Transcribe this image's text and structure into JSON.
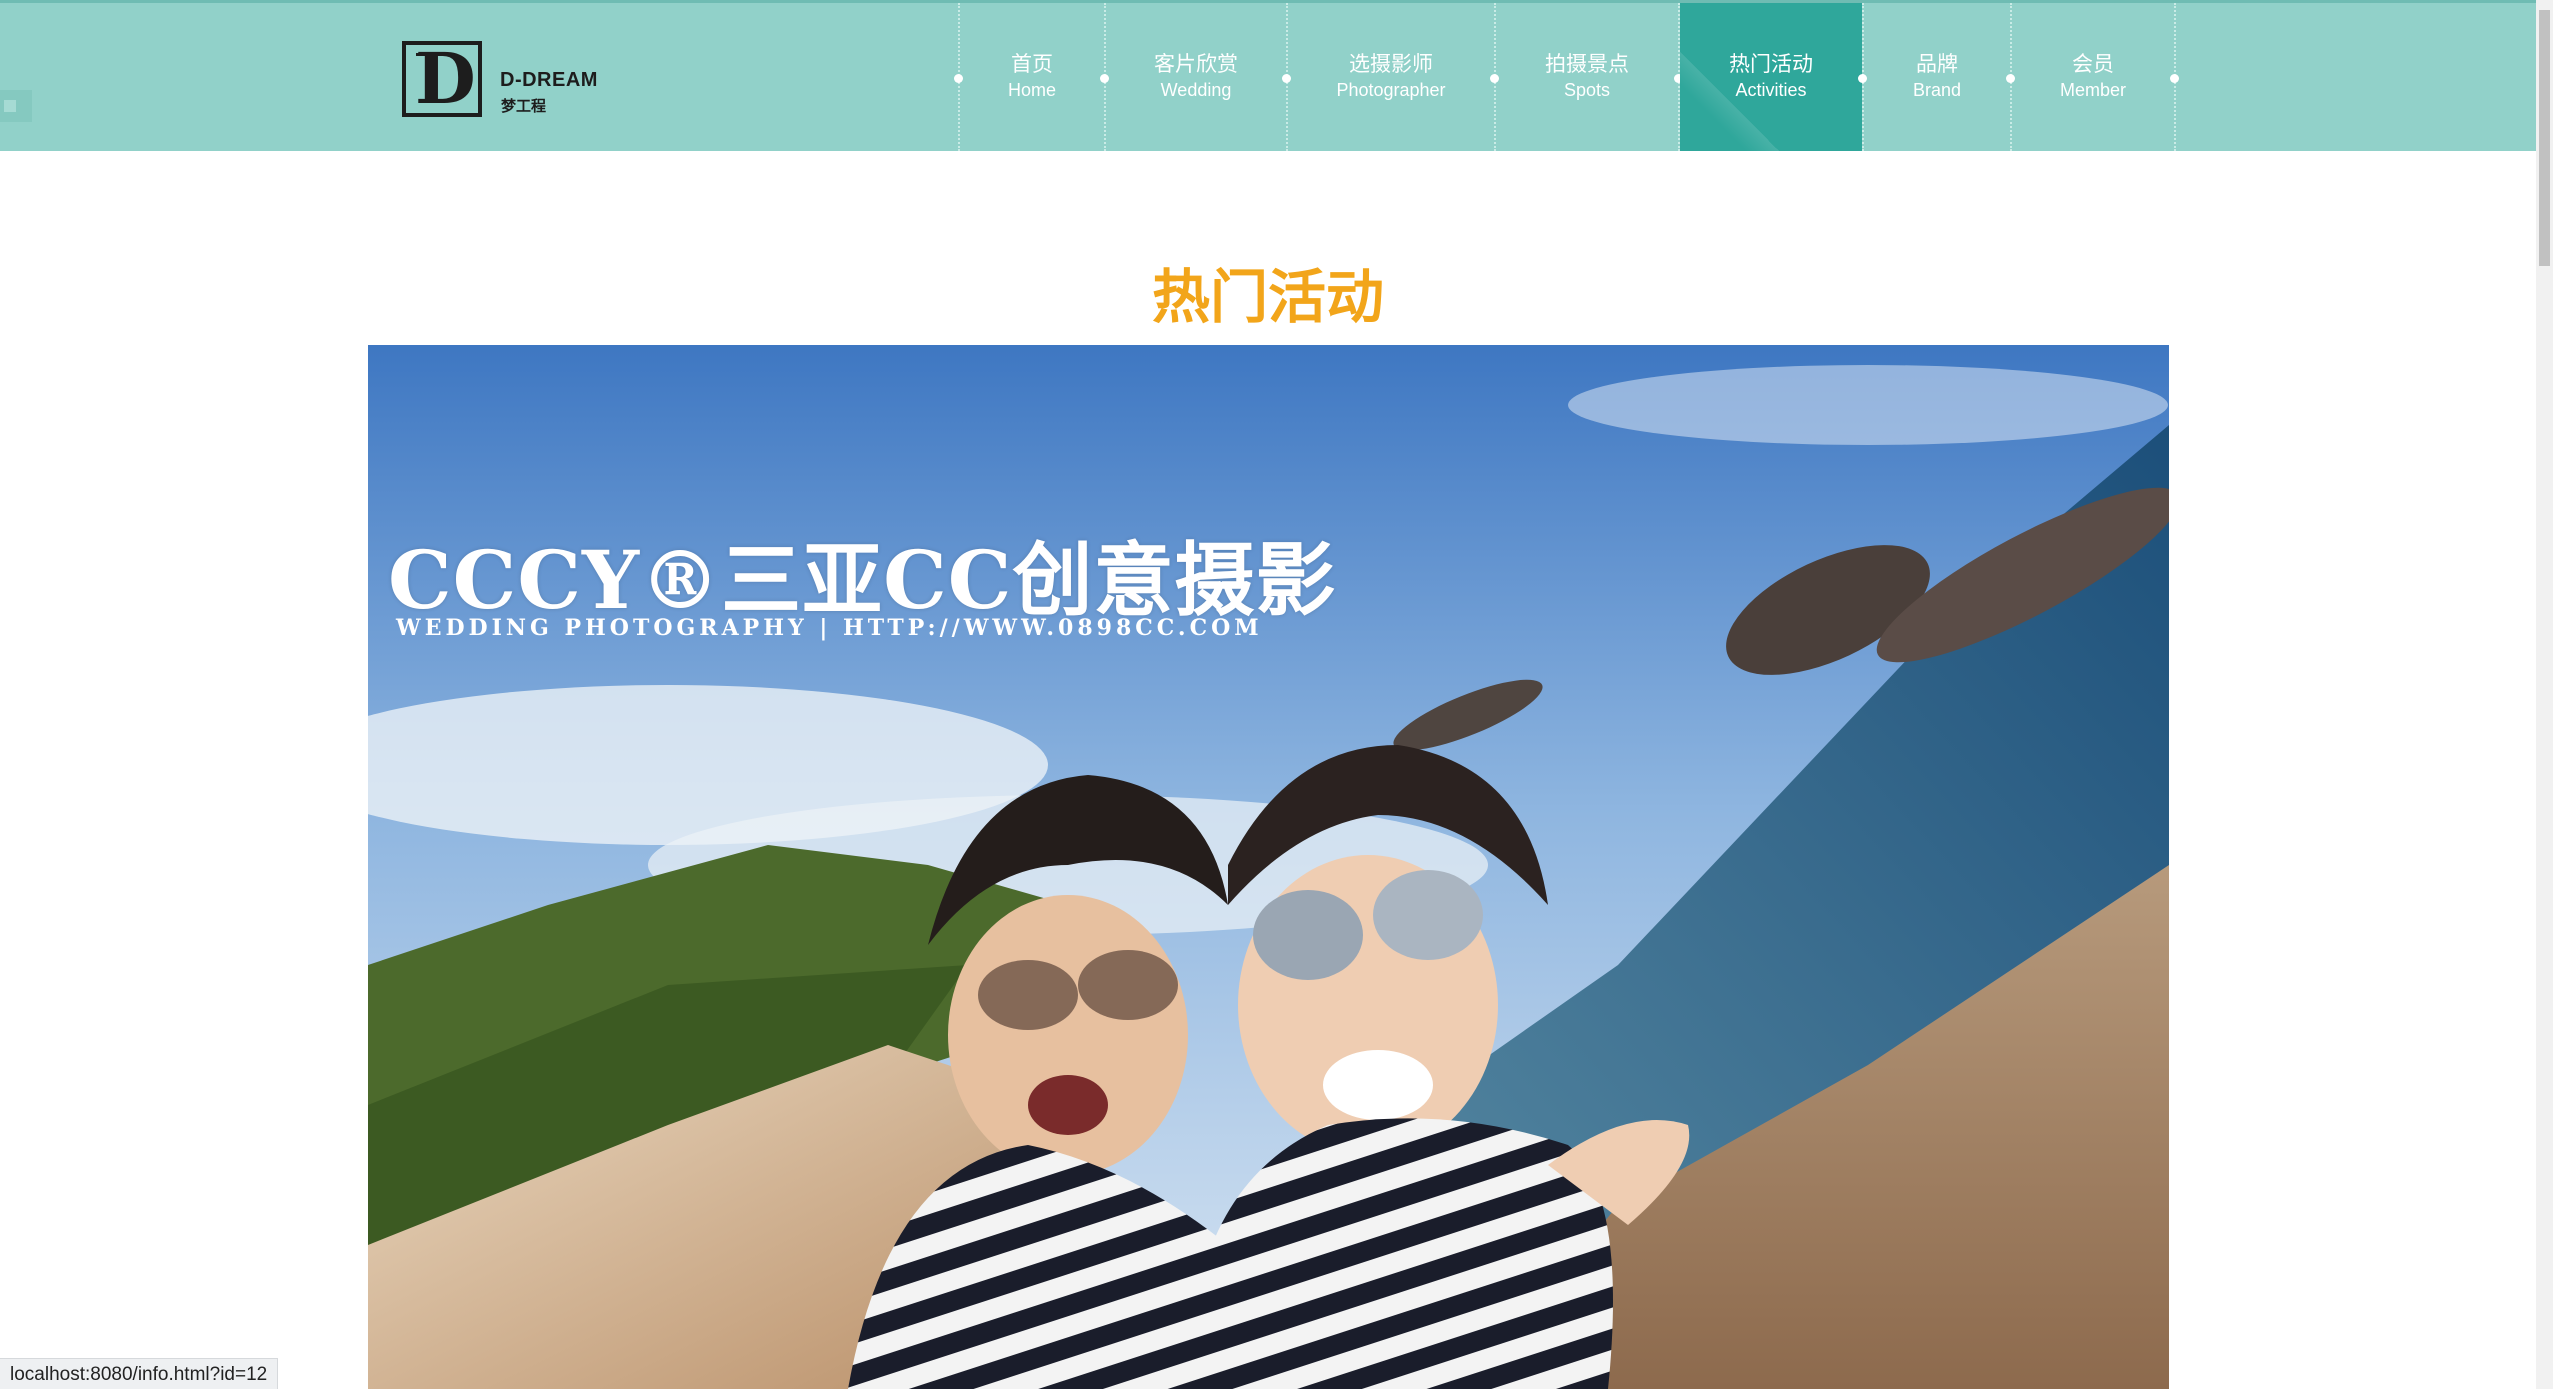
{
  "logo": {
    "letter": "D",
    "name_en": "D-DREAM",
    "name_cn": "梦工程"
  },
  "nav": [
    {
      "cn": "首页",
      "en": "Home",
      "active": false
    },
    {
      "cn": "客片欣赏",
      "en": "Wedding",
      "active": false
    },
    {
      "cn": "选摄影师",
      "en": "Photographer",
      "active": false
    },
    {
      "cn": "拍摄景点",
      "en": "Spots",
      "active": false
    },
    {
      "cn": "热门活动",
      "en": "Activities",
      "active": true
    },
    {
      "cn": "品牌",
      "en": "Brand",
      "active": false
    },
    {
      "cn": "会员",
      "en": "Member",
      "active": false
    }
  ],
  "section": {
    "title": "热门活动"
  },
  "photo": {
    "watermark_brand": "CCCY®三亚CC创意摄影",
    "watermark_sub": "WEDDING PHOTOGRAPHY | HTTP://WWW.0898CC.COM"
  },
  "status": {
    "url": "localhost:8080/info.html?id=12"
  },
  "colors": {
    "header": "#91d1c9",
    "nav_active": "#2fa79b",
    "title": "#f2a51a"
  }
}
